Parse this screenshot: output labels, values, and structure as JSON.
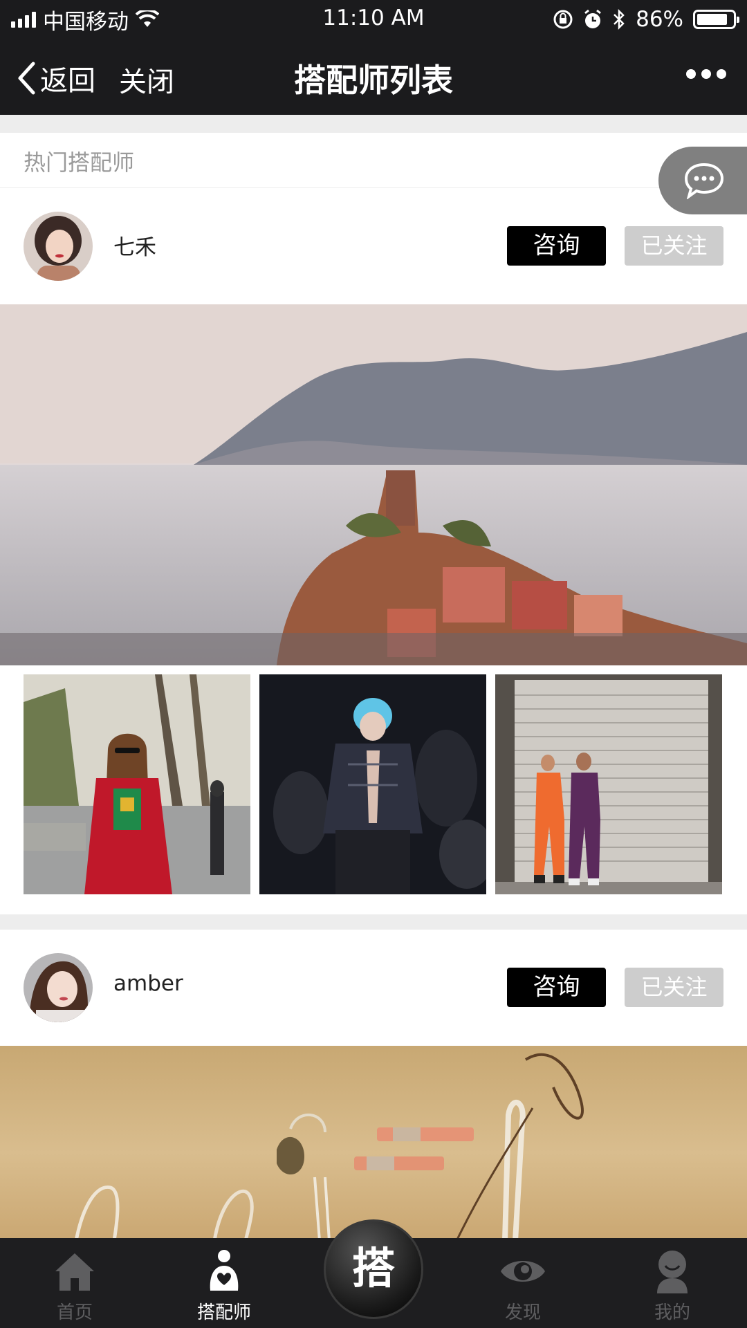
{
  "status_bar": {
    "carrier": "中国移动",
    "time": "11:10 AM",
    "battery": "86%",
    "battery_level": 0.86
  },
  "nav": {
    "back_label": "返回",
    "close_label": "关闭",
    "title": "搭配师列表"
  },
  "section": {
    "title": "热门搭配师"
  },
  "stylists": [
    {
      "name": "七禾",
      "consult_label": "咨询",
      "follow_label": "已关注"
    },
    {
      "name": "amber",
      "consult_label": "咨询",
      "follow_label": "已关注"
    }
  ],
  "tabbar": {
    "items": [
      {
        "label": "首页",
        "icon": "home-icon"
      },
      {
        "label": "搭配师",
        "icon": "stylist-icon"
      },
      {
        "label": "发现",
        "icon": "eye-icon"
      },
      {
        "label": "我的",
        "icon": "profile-icon"
      }
    ],
    "center_label": "搭",
    "active": "搭配师"
  },
  "colors": {
    "bar_bg": "#1b1b1d",
    "consult_bg": "#000000",
    "follow_bg": "#cdcdcd"
  }
}
